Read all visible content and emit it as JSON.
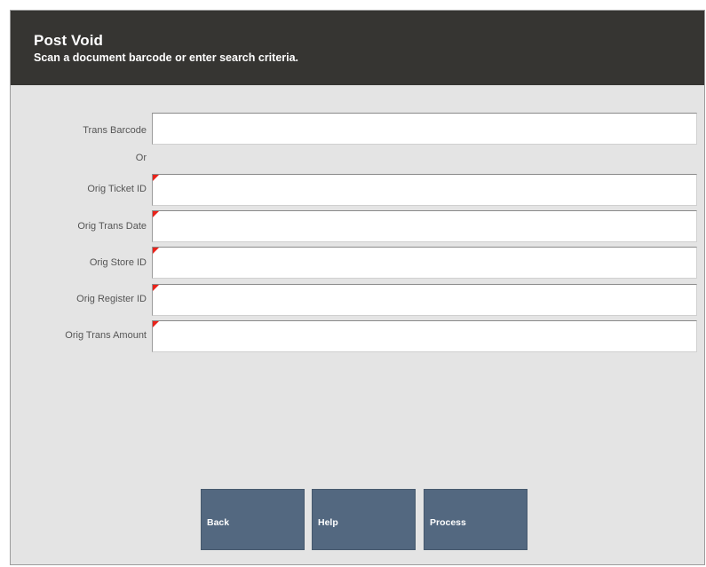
{
  "header": {
    "title": "Post Void",
    "subtitle": "Scan a document barcode or enter search criteria."
  },
  "form": {
    "trans_barcode_label": "Trans Barcode",
    "trans_barcode_value": "",
    "or_label": "Or",
    "orig_ticket_id_label": "Orig Ticket ID",
    "orig_ticket_id_value": "",
    "orig_trans_date_label": "Orig Trans Date",
    "orig_trans_date_value": "",
    "orig_store_id_label": "Orig Store ID",
    "orig_store_id_value": "",
    "orig_register_id_label": "Orig Register ID",
    "orig_register_id_value": "",
    "orig_trans_amount_label": "Orig Trans Amount",
    "orig_trans_amount_value": ""
  },
  "buttons": {
    "back_label": "Back",
    "help_label": "Help",
    "process_label": "Process"
  },
  "colors": {
    "header_bg": "#363532",
    "panel_bg": "#e4e4e4",
    "button_bg": "#536880",
    "required_marker": "#e8231b"
  }
}
